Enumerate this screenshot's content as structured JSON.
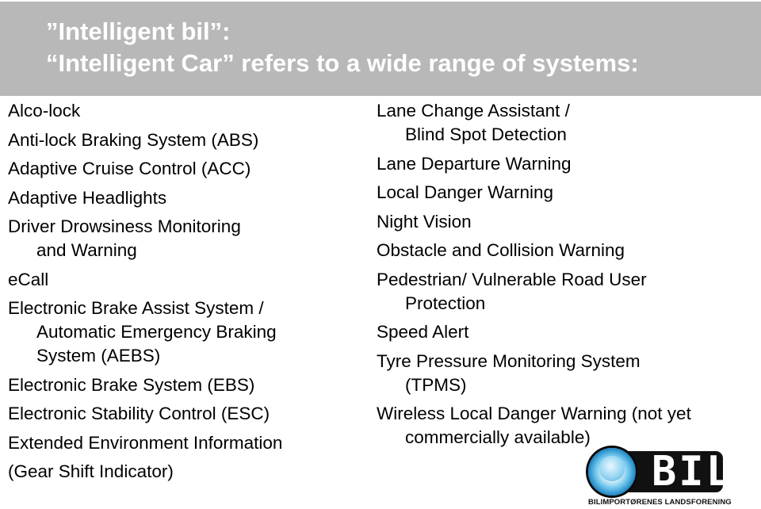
{
  "header": {
    "title_line1": "”Intelligent bil”:",
    "title_line2": "“Intelligent Car” refers to a wide range of systems:",
    "background_color": "#b8b8b8",
    "text_color": "#ffffff"
  },
  "left_column": {
    "items": [
      {
        "text": "Alco-lock"
      },
      {
        "text": "Anti-lock Braking System (ABS)"
      },
      {
        "text": "Adaptive Cruise Control (ACC)"
      },
      {
        "text": "Adaptive Headlights"
      },
      {
        "text": "Driver Drowsiness Monitoring",
        "cont": [
          "and Warning"
        ]
      },
      {
        "text": "eCall"
      },
      {
        "text": "Electronic Brake Assist System /",
        "cont": [
          "Automatic Emergency Braking",
          "System (AEBS)"
        ]
      },
      {
        "text": "Electronic Brake System (EBS)"
      },
      {
        "text": "Electronic Stability Control (ESC)"
      },
      {
        "text": "Extended Environment Information"
      },
      {
        "text": "(Gear Shift Indicator)"
      }
    ]
  },
  "right_column": {
    "items": [
      {
        "text": "Lane Change Assistant /",
        "cont": [
          "Blind Spot Detection"
        ]
      },
      {
        "text": "Lane Departure Warning"
      },
      {
        "text": "Local Danger Warning"
      },
      {
        "text": "Night Vision"
      },
      {
        "text": "Obstacle and Collision Warning"
      },
      {
        "text": "Pedestrian/ Vulnerable Road User",
        "cont": [
          "Protection"
        ]
      },
      {
        "text": "Speed Alert"
      },
      {
        "text": "Tyre Pressure Monitoring System",
        "cont": [
          "(TPMS)"
        ]
      },
      {
        "text": "Wireless Local Danger Warning (not yet",
        "cont": [
          "commercially available)"
        ]
      }
    ]
  },
  "logo": {
    "icon": "bil-circle-logo-icon",
    "mark": "BIL",
    "subtitle": "BILIMPORTØRENES LANDSFORENING",
    "accent_color": "#4aa6d8"
  }
}
